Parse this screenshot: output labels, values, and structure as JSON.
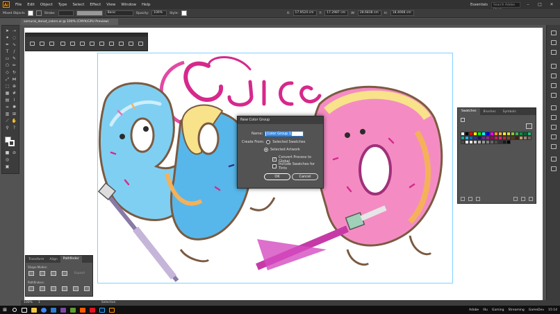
{
  "app": {
    "logo": "Ai",
    "menu": [
      "File",
      "Edit",
      "Object",
      "Type",
      "Select",
      "Effect",
      "View",
      "Window",
      "Help"
    ],
    "workspace": "Essentials",
    "search_placeholder": "Search Adobe Stock"
  },
  "control_bar": {
    "selection_label": "Mixed Objects",
    "stroke_label": "Stroke:",
    "style_label": "Basic",
    "opacity_label": "Opacity:",
    "opacity_value": "100%",
    "style_word": "Style:",
    "x_value": "17.9524 cm",
    "y_value": "17.2987 cm",
    "w_value": "28.6838 cm",
    "h_value": "18.4008 cm"
  },
  "document": {
    "tab_title": "samurai_donut_colors.ai @ 100% (CMYK/GPU Preview)"
  },
  "swatches_panel": {
    "tabs": [
      "Swatches",
      "Brushes",
      "Symbols"
    ],
    "colors": [
      "#ffffff",
      "#000000",
      "#ff0000",
      "#ffff00",
      "#00ff00",
      "#00ffff",
      "#0000ff",
      "#ff00ff",
      "#f7931e",
      "#fbb03b",
      "#fcee21",
      "#d9e021",
      "#8cc63f",
      "#39b54a",
      "#009245",
      "#006837",
      "#22b573",
      "#00a99d",
      "#29abe2",
      "#0071bc",
      "#2e3192",
      "#1b1464",
      "#662d91",
      "#93278f",
      "#9e005d",
      "#d4145a",
      "#ed1e79",
      "#c1272d",
      "#754c24",
      "#603813",
      "#42210b",
      "#c69c6d",
      "#998675",
      "#736357",
      "#534741",
      "#ffffff",
      "#e6e6e6",
      "#cccccc",
      "#b3b3b3",
      "#999999",
      "#808080",
      "#666666",
      "#4d4d4d",
      "#333333",
      "#1a1a1a",
      "#000000"
    ]
  },
  "pathfinder_panel": {
    "tabs": [
      "Transform",
      "Align",
      "Pathfinder"
    ],
    "shape_modes_label": "Shape Modes:",
    "pathfinders_label": "Pathfinders:",
    "expand_label": "Expand"
  },
  "dialog": {
    "title": "New Color Group",
    "name_label": "Name:",
    "name_value": "Color Group 1",
    "create_from_label": "Create From:",
    "option_selected_swatches": "Selected Swatches",
    "option_selected_artwork": "Selected Artwork",
    "convert_process": "Convert Process to Global",
    "include_tints": "Include Swatches for Tints",
    "ok": "OK",
    "cancel": "Cancel",
    "selected_option": "Selected Artwork",
    "convert_checked": true,
    "tints_checked": false
  },
  "status_bar": {
    "zoom": "100%",
    "page": "1",
    "tool": "Selection"
  },
  "taskbar": {
    "tray_items": [
      "Adobe",
      "Illu",
      "Gaming",
      "Streaming",
      "GameDev"
    ],
    "time": "15:14"
  },
  "colors": {
    "artwork_blue": "#6cc6ee",
    "artwork_pink": "#f06aaa",
    "artwork_magenta": "#d6298b",
    "artwork_orange": "#f5b15a",
    "artwork_outline": "#7b5a40",
    "selection_blue": "#7fd1ff"
  }
}
